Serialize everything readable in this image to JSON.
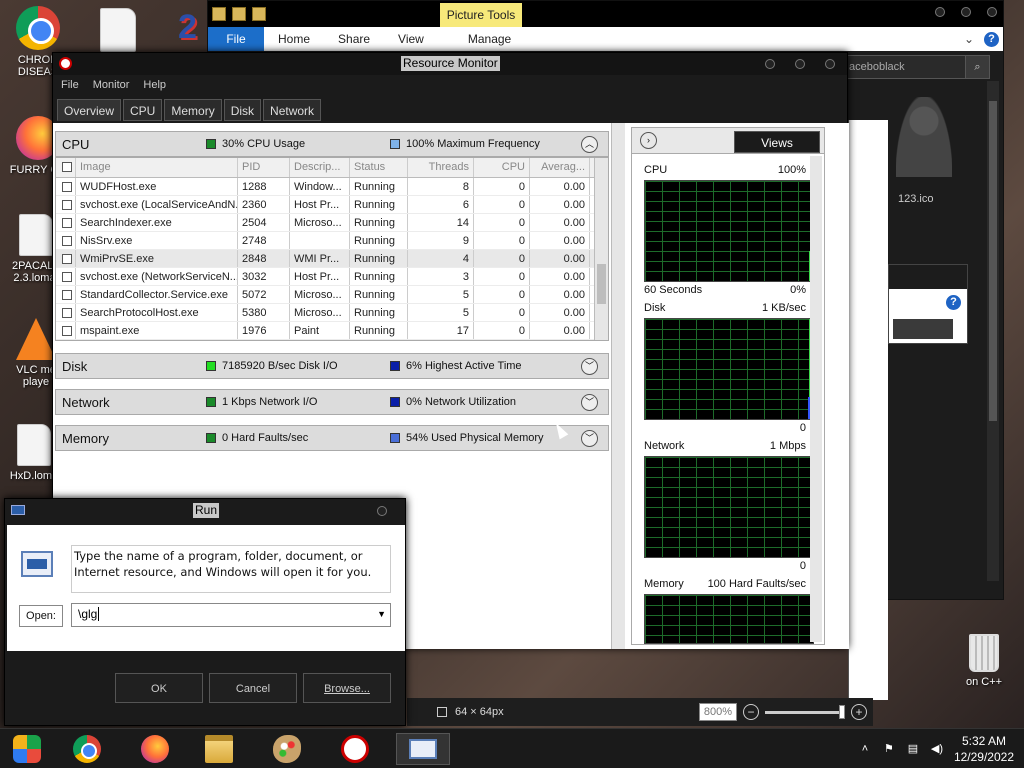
{
  "desktop": {
    "icons": [
      {
        "label": "CHRON\nDISEAS"
      },
      {
        "label": "FURRY CU"
      },
      {
        "label": "2PACALY\n2.3.lomat"
      },
      {
        "label": "VLC me\nplaye"
      },
      {
        "label": "HxD.loma"
      },
      {
        "label": "on C++"
      }
    ]
  },
  "explorer": {
    "context_tab": "Picture Tools",
    "tabs": [
      "File",
      "Home",
      "Share",
      "View",
      "Manage"
    ],
    "search_text": "aceboblack",
    "thumb_label": "123.ico",
    "side_text_1": "dit",
    "side_text_2": "ors"
  },
  "paint": {
    "status_size": "64 × 64px",
    "zoom": "800%"
  },
  "resmon": {
    "title": "Resource Monitor",
    "menu": [
      "File",
      "Monitor",
      "Help"
    ],
    "tabs": [
      "Overview",
      "CPU",
      "Memory",
      "Disk",
      "Network"
    ],
    "sections": {
      "cpu": {
        "name": "CPU",
        "m1": "30% CPU Usage",
        "m2": "100% Maximum Frequency",
        "c1": "#1a8a2a",
        "c2": "#7fb2e8"
      },
      "disk": {
        "name": "Disk",
        "m1": "7185920 B/sec Disk I/O",
        "m2": "6% Highest Active Time",
        "c1": "#22dd22",
        "c2": "#0a1fa8"
      },
      "network": {
        "name": "Network",
        "m1": "1 Kbps Network I/O",
        "m2": "0% Network Utilization",
        "c1": "#1a8a2a",
        "c2": "#0a1fa8"
      },
      "memory": {
        "name": "Memory",
        "m1": "0 Hard Faults/sec",
        "m2": "54% Used Physical Memory",
        "c1": "#1a8a2a",
        "c2": "#4a6fd8"
      }
    },
    "columns": [
      "Image",
      "PID",
      "Descrip...",
      "Status",
      "Threads",
      "CPU",
      "Averag..."
    ],
    "rows": [
      {
        "image": "WUDFHost.exe",
        "pid": "1288",
        "desc": "Window...",
        "status": "Running",
        "threads": "8",
        "cpu": "0",
        "avg": "0.00"
      },
      {
        "image": "svchost.exe (LocalServiceAndN...",
        "pid": "2360",
        "desc": "Host Pr...",
        "status": "Running",
        "threads": "6",
        "cpu": "0",
        "avg": "0.00"
      },
      {
        "image": "SearchIndexer.exe",
        "pid": "2504",
        "desc": "Microso...",
        "status": "Running",
        "threads": "14",
        "cpu": "0",
        "avg": "0.00"
      },
      {
        "image": "NisSrv.exe",
        "pid": "2748",
        "desc": "",
        "status": "Running",
        "threads": "9",
        "cpu": "0",
        "avg": "0.00"
      },
      {
        "image": "WmiPrvSE.exe",
        "pid": "2848",
        "desc": "WMI Pr...",
        "status": "Running",
        "threads": "4",
        "cpu": "0",
        "avg": "0.00"
      },
      {
        "image": "svchost.exe (NetworkServiceN...",
        "pid": "3032",
        "desc": "Host Pr...",
        "status": "Running",
        "threads": "3",
        "cpu": "0",
        "avg": "0.00"
      },
      {
        "image": "StandardCollector.Service.exe",
        "pid": "5072",
        "desc": "Microso...",
        "status": "Running",
        "threads": "5",
        "cpu": "0",
        "avg": "0.00"
      },
      {
        "image": "SearchProtocolHost.exe",
        "pid": "5380",
        "desc": "Microso...",
        "status": "Running",
        "threads": "5",
        "cpu": "0",
        "avg": "0.00"
      },
      {
        "image": "mspaint.exe",
        "pid": "1976",
        "desc": "Paint",
        "status": "Running",
        "threads": "17",
        "cpu": "0",
        "avg": "0.00"
      }
    ],
    "views_button": "Views",
    "graphs": {
      "cpu": {
        "label": "CPU",
        "max": "100%",
        "time": "60 Seconds",
        "min": "0%"
      },
      "disk": {
        "label": "Disk",
        "max": "1 KB/sec",
        "min": "0"
      },
      "network": {
        "label": "Network",
        "max": "1 Mbps",
        "min": "0"
      },
      "memory": {
        "label": "Memory",
        "max": "100 Hard Faults/sec"
      }
    }
  },
  "run": {
    "title": "Run",
    "description": "Type the name of a program, folder, document, or Internet resource, and Windows will open it for you.",
    "open_label": "Open:",
    "open_value": "\\glg",
    "ok": "OK",
    "cancel": "Cancel",
    "browse": "Browse..."
  },
  "taskbar": {
    "time": "5:32 AM",
    "date": "12/29/2022"
  }
}
